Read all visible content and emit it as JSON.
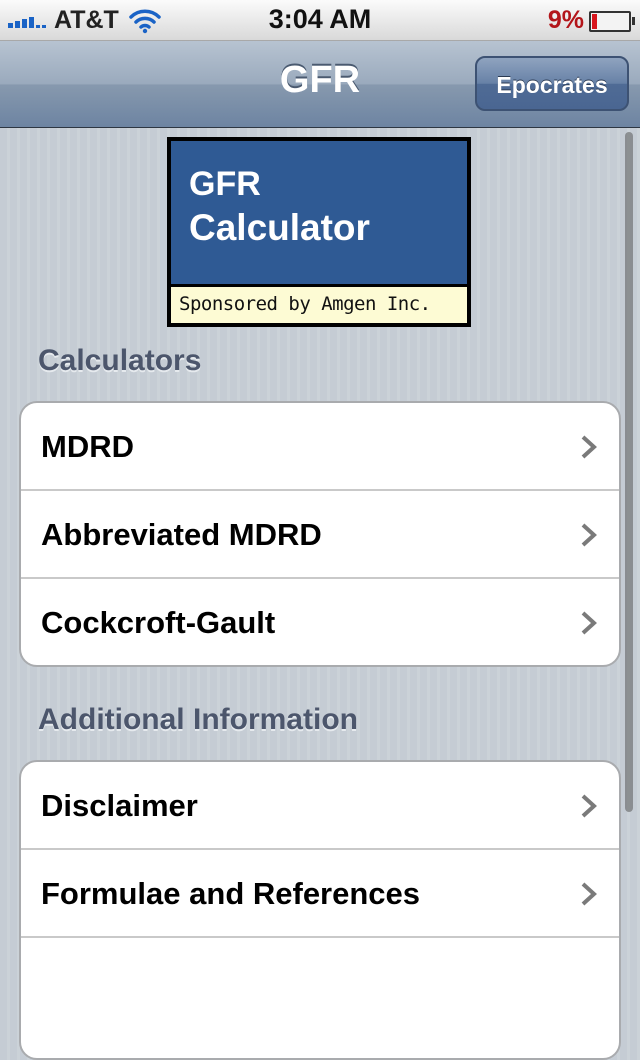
{
  "status_bar": {
    "carrier": "AT&T",
    "time": "3:04 AM",
    "battery_percent": "9%",
    "battery_level": 0.09,
    "signal_bars": 4,
    "icons": [
      "signal-icon",
      "wifi-icon",
      "battery-icon"
    ]
  },
  "nav": {
    "title": "GFR",
    "right_button": "Epocrates"
  },
  "banner": {
    "line1": "GFR",
    "line2": "Calculator",
    "sponsor": "Sponsored by Amgen Inc."
  },
  "sections": [
    {
      "header": "Calculators",
      "items": [
        {
          "label": "MDRD"
        },
        {
          "label": "Abbreviated MDRD"
        },
        {
          "label": "Cockcroft-Gault"
        }
      ]
    },
    {
      "header": "Additional Information",
      "items": [
        {
          "label": "Disclaimer"
        },
        {
          "label": "Formulae and References"
        },
        {
          "label": ""
        }
      ]
    }
  ],
  "colors": {
    "navbar": "#7d91ab",
    "banner_blue": "#2f5a94",
    "sponsor_bg": "#fdfbd4",
    "battery_red": "#d8151d",
    "signal_blue": "#1a63c6"
  }
}
